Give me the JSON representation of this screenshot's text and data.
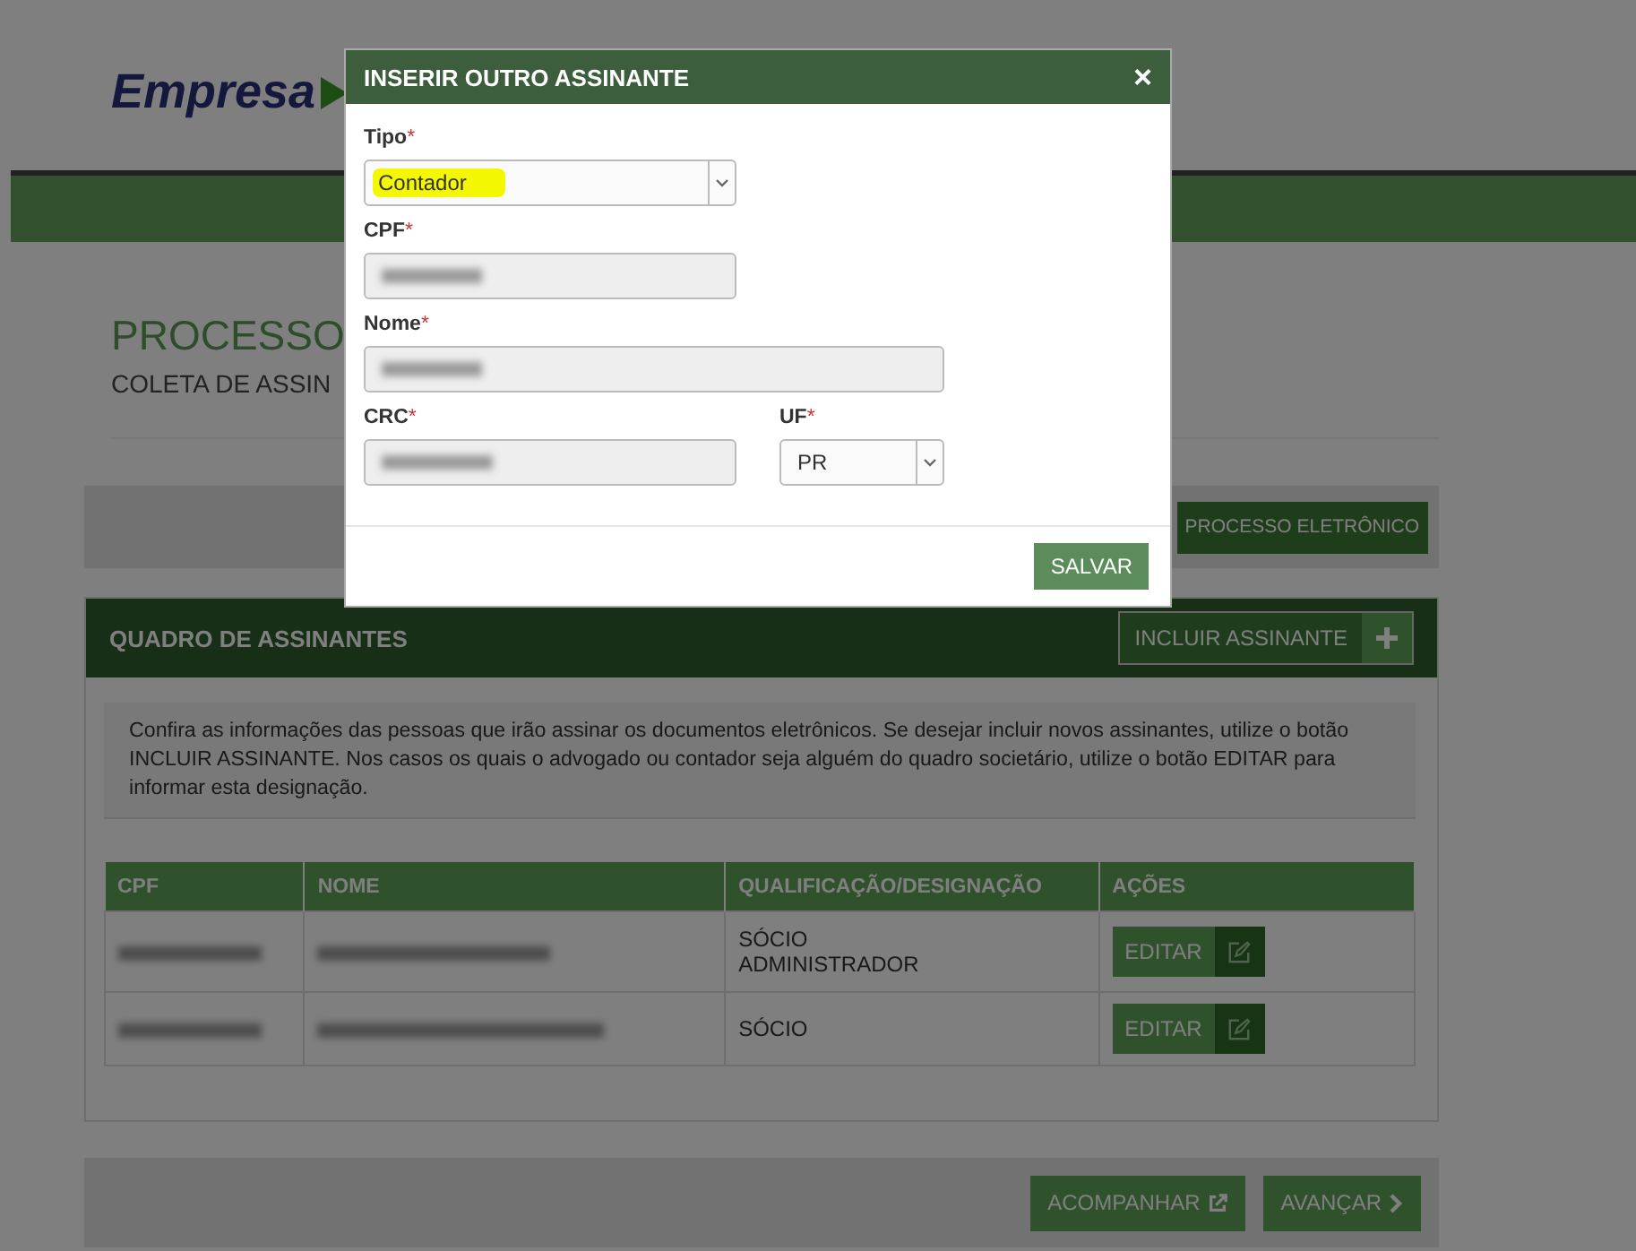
{
  "logo": {
    "text": "Empresa"
  },
  "page": {
    "title": "PROCESSO",
    "subtitle": "COLETA DE ASSIN"
  },
  "action_bar": {
    "button": "PROCESSO ELETRÔNICO"
  },
  "panel": {
    "title": "QUADRO DE ASSINANTES",
    "add_button": "INCLUIR ASSINANTE",
    "info": "Confira as informações das pessoas que irão assinar os documentos eletrônicos. Se desejar incluir novos assinantes, utilize o botão INCLUIR ASSINANTE. Nos casos os quais o advogado ou contador seja alguém do quadro societário, utilize o botão EDITAR para informar esta designação.",
    "table": {
      "columns": [
        "CPF",
        "NOME",
        "QUALIFICAÇÃO/DESIGNAÇÃO",
        "AÇÕES"
      ],
      "rows": [
        {
          "cpf_redacted": true,
          "name_redacted": true,
          "qualification": "SÓCIO\nADMINISTRADOR",
          "action": "EDITAR"
        },
        {
          "cpf_redacted": true,
          "name_redacted": true,
          "qualification": "SÓCIO",
          "action": "EDITAR"
        }
      ]
    }
  },
  "footer": {
    "buttons": [
      {
        "label": "ACOMPANHAR",
        "kind": "external"
      },
      {
        "label": "AVANÇAR",
        "kind": "next"
      }
    ]
  },
  "modal": {
    "title": "INSERIR OUTRO ASSINANTE",
    "close": "×",
    "fields": [
      {
        "label": "Tipo",
        "required_mark": "*",
        "kind": "select",
        "value": "Contador",
        "highlighted": true
      },
      {
        "label": "CPF",
        "required_mark": "*",
        "kind": "text",
        "redacted": true
      },
      {
        "label": "Nome",
        "required_mark": "*",
        "kind": "text",
        "redacted": true
      },
      {
        "label": "CRC",
        "required_mark": "*",
        "kind": "text",
        "redacted": true
      },
      {
        "label": "UF",
        "required_mark": "*",
        "kind": "select",
        "value": "PR",
        "highlighted": false
      }
    ],
    "save_button": "SALVAR"
  }
}
